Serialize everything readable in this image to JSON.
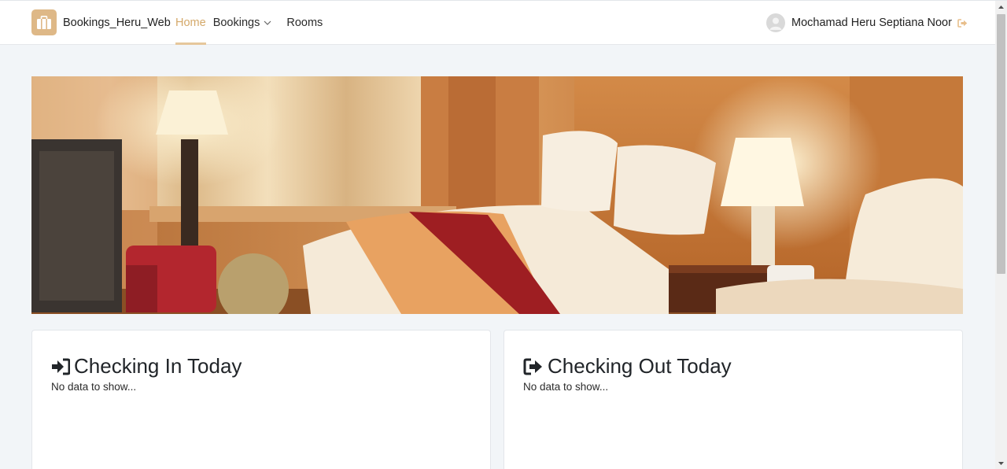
{
  "brand": {
    "name": "Bookings_Heru_Web",
    "logo_icon": "briefcase-icon",
    "logo_color": "#deb887"
  },
  "nav": {
    "home": "Home",
    "bookings": "Bookings",
    "rooms": "Rooms",
    "active": "Home",
    "active_color": "#d4a96a"
  },
  "user": {
    "name": "Mochamad Heru Septiana Noor",
    "logout_icon": "sign-out-icon"
  },
  "hero": {
    "description_icon": "hotel-room-photo"
  },
  "cards": {
    "checking_in": {
      "title": "Checking In Today",
      "empty": "No data to show...",
      "icon": "sign-in-icon"
    },
    "checking_out": {
      "title": "Checking Out Today",
      "empty": "No data to show...",
      "icon": "sign-out-icon"
    }
  }
}
